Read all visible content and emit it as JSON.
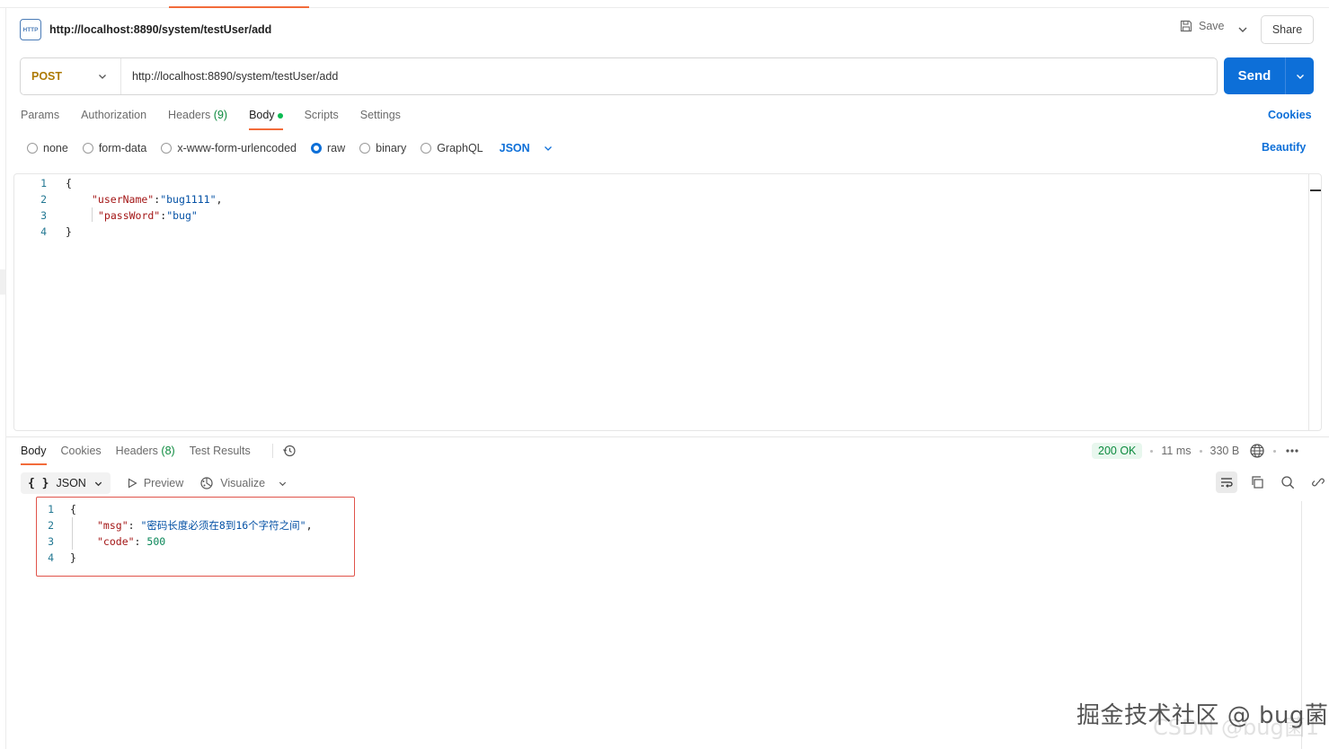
{
  "header": {
    "icon_text": "HTTP",
    "title": "http://localhost:8890/system/testUser/add",
    "save_label": "Save",
    "share_label": "Share"
  },
  "request": {
    "method": "POST",
    "url": "http://localhost:8890/system/testUser/add",
    "send_label": "Send"
  },
  "request_tabs": {
    "params": "Params",
    "authorization": "Authorization",
    "headers": "Headers",
    "headers_count": "(9)",
    "body": "Body",
    "scripts": "Scripts",
    "settings": "Settings",
    "cookies": "Cookies",
    "active": "Body"
  },
  "body_types": {
    "none": "none",
    "form_data": "form-data",
    "urlencoded": "x-www-form-urlencoded",
    "raw": "raw",
    "binary": "binary",
    "graphql": "GraphQL",
    "format": "JSON",
    "selected": "raw",
    "beautify": "Beautify"
  },
  "request_body": {
    "lines": [
      "1",
      "2",
      "3",
      "4"
    ],
    "open_brace": "{",
    "key1": "\"userName\"",
    "val1": "\"bug1111\"",
    "key2": "\"passWord\"",
    "val2": "\"bug\"",
    "close_brace": "}"
  },
  "response_tabs": {
    "body": "Body",
    "cookies": "Cookies",
    "headers": "Headers",
    "headers_count": "(8)",
    "test_results": "Test Results",
    "active": "Body"
  },
  "response_status": {
    "status": "200 OK",
    "time": "11 ms",
    "size": "330 B"
  },
  "response_toolbar": {
    "format": "JSON",
    "format_icon": "{ }",
    "preview": "Preview",
    "visualize": "Visualize"
  },
  "response_body": {
    "lines": [
      "1",
      "2",
      "3",
      "4"
    ],
    "open_brace": "{",
    "key1": "\"msg\"",
    "val1": "\"密码长度必须在8到16个字符之间\"",
    "key2": "\"code\"",
    "val2": "500",
    "close_brace": "}"
  },
  "watermark": {
    "text": "掘金技术社区 @ bug菌",
    "text2": "CSDN @bug菌1"
  },
  "colors": {
    "accent": "#f26b3a",
    "send": "#0d6fd8",
    "method": "#ad7a03",
    "status_ok": "#0c8a3e",
    "highlight": "#e0534a"
  }
}
